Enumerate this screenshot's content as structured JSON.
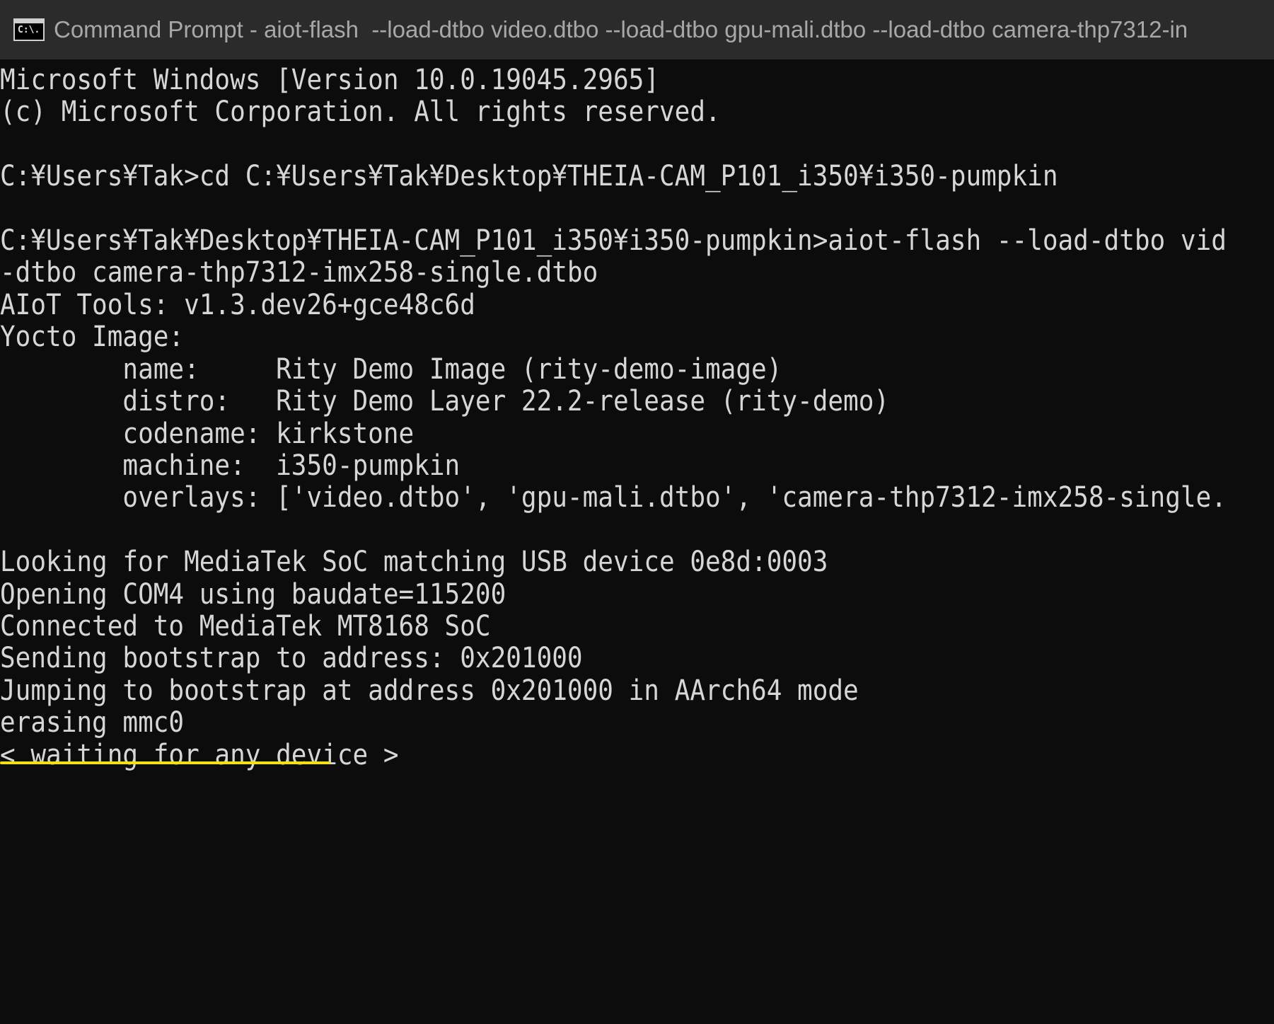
{
  "window": {
    "title": "Command Prompt - aiot-flash  --load-dtbo video.dtbo --load-dtbo gpu-mali.dtbo --load-dtbo camera-thp7312-in",
    "icon": "cmd-icon",
    "icon_text": "C:\\."
  },
  "colors": {
    "background": "#0c0c0c",
    "text": "#d6d6d6",
    "titlebar": "#2b2b2b",
    "highlight_underline": "#f2e10f"
  },
  "console": {
    "lines": [
      "Microsoft Windows [Version 10.0.19045.2965]",
      "(c) Microsoft Corporation. All rights reserved.",
      "",
      "C:¥Users¥Tak>cd C:¥Users¥Tak¥Desktop¥THEIA-CAM_P101_i350¥i350-pumpkin",
      "",
      "C:¥Users¥Tak¥Desktop¥THEIA-CAM_P101_i350¥i350-pumpkin>aiot-flash --load-dtbo vid",
      "-dtbo camera-thp7312-imx258-single.dtbo",
      "AIoT Tools: v1.3.dev26+gce48c6d",
      "Yocto Image:",
      "        name:     Rity Demo Image (rity-demo-image)",
      "        distro:   Rity Demo Layer 22.2-release (rity-demo)",
      "        codename: kirkstone",
      "        machine:  i350-pumpkin",
      "        overlays: ['video.dtbo', 'gpu-mali.dtbo', 'camera-thp7312-imx258-single.",
      "",
      "Looking for MediaTek SoC matching USB device 0e8d:0003",
      "Opening COM4 using baudate=115200",
      "Connected to MediaTek MT8168 SoC",
      "Sending bootstrap to address: 0x201000",
      "Jumping to bootstrap at address 0x201000 in AArch64 mode",
      "erasing mmc0",
      "< waiting for any device >"
    ]
  }
}
